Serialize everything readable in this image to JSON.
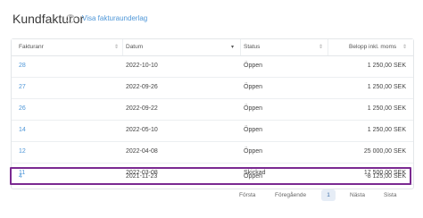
{
  "page": {
    "title": "Kundfakturor",
    "help_icon": "question-circle-icon",
    "link": "Visa fakturaunderlag"
  },
  "table": {
    "columns": [
      "Fakturanr",
      "Datum",
      "Status",
      "Belopp inkl. moms"
    ],
    "sort_icon": "sort-arrows-icon",
    "active_sort_icon": "caret-down-icon",
    "rows": [
      {
        "number": "28",
        "date": "2022-10-10",
        "status": "Öppen",
        "amount": "1 250,00 SEK"
      },
      {
        "number": "27",
        "date": "2022-09-26",
        "status": "Öppen",
        "amount": "1 250,00 SEK"
      },
      {
        "number": "26",
        "date": "2022-09-22",
        "status": "Öppen",
        "amount": "1 250,00 SEK"
      },
      {
        "number": "14",
        "date": "2022-05-10",
        "status": "Öppen",
        "amount": "1 250,00 SEK"
      },
      {
        "number": "12",
        "date": "2022-04-08",
        "status": "Öppen",
        "amount": "25 000,00 SEK"
      },
      {
        "number": "11",
        "date": "2022-03-08",
        "status": "Skickad",
        "amount": "17 500,00 SEK"
      },
      {
        "number": "4",
        "date": "2021-11-23",
        "status": "Öppen",
        "amount": "-8 125,00 SEK"
      }
    ],
    "highlight_color": "#7b2a91"
  },
  "pagination": {
    "first": "Första",
    "previous": "Föregående",
    "current": "1",
    "next": "Nästa",
    "last": "Sista"
  }
}
